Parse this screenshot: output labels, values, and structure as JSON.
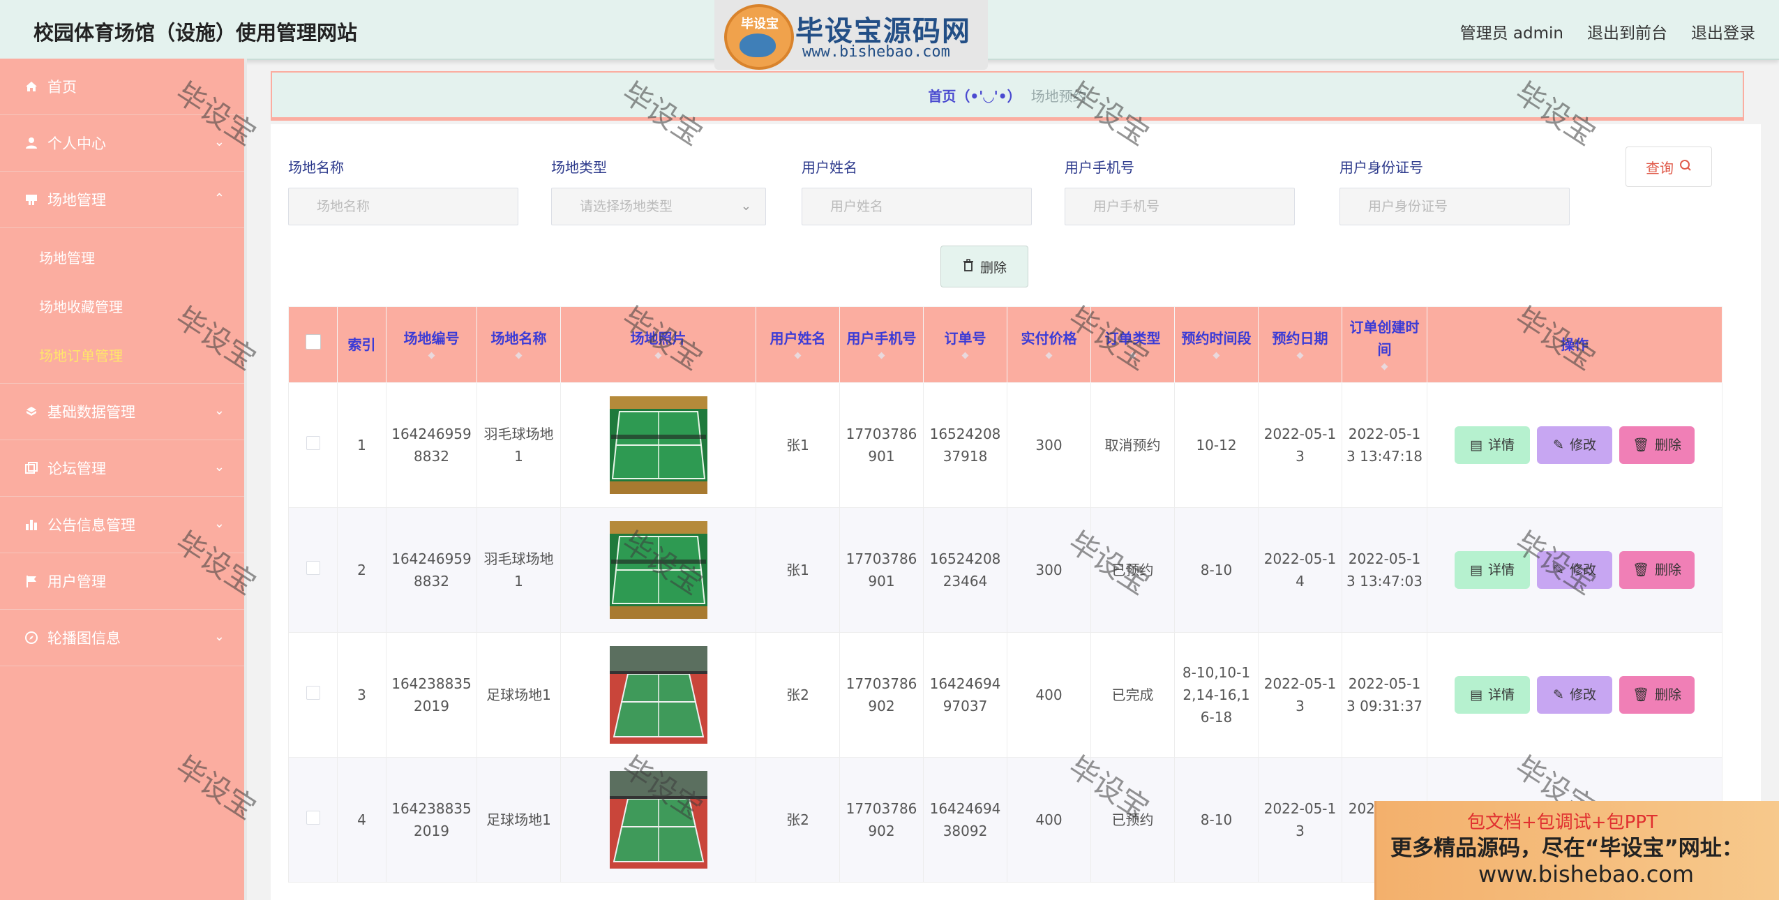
{
  "app": {
    "title": "校园体育场馆（设施）使用管理网站"
  },
  "header": {
    "user_label": "管理员 admin",
    "back_to_front": "退出到前台",
    "logout": "退出登录"
  },
  "logo": {
    "badge": "毕设宝",
    "main": "毕设宝源码网",
    "url": "www.bishebao.com"
  },
  "sidebar": {
    "items": [
      {
        "label": "首页",
        "icon": "home-icon"
      },
      {
        "label": "个人中心",
        "icon": "user-icon"
      },
      {
        "label": "场地管理",
        "icon": "venue-icon",
        "expanded": true,
        "children": [
          "场地管理",
          "场地收藏管理",
          "场地订单管理"
        ],
        "active_child": 2
      },
      {
        "label": "基础数据管理",
        "icon": "database-icon"
      },
      {
        "label": "论坛管理",
        "icon": "forum-icon"
      },
      {
        "label": "公告信息管理",
        "icon": "chart-icon"
      },
      {
        "label": "用户管理",
        "icon": "flag-icon"
      },
      {
        "label": "轮播图信息",
        "icon": "compass-icon"
      }
    ]
  },
  "breadcrumb": {
    "home": "首页（•'◡'•）",
    "current": "场地预约"
  },
  "search": {
    "fields": [
      {
        "label": "场地名称",
        "placeholder": "场地名称"
      },
      {
        "label": "场地类型",
        "placeholder": "请选择场地类型"
      },
      {
        "label": "用户姓名",
        "placeholder": "用户姓名"
      },
      {
        "label": "用户手机号",
        "placeholder": "用户手机号"
      },
      {
        "label": "用户身份证号",
        "placeholder": "用户身份证号"
      }
    ],
    "query_button": "查询",
    "delete_button": "删除"
  },
  "table": {
    "headers": [
      "索引",
      "场地编号",
      "场地名称",
      "场地照片",
      "用户姓名",
      "用户手机号",
      "订单号",
      "实付价格",
      "订单类型",
      "预约时间段",
      "预约日期",
      "订单创建时间",
      "操作"
    ],
    "rows": [
      {
        "index": "1",
        "venue_no": "1642469598832",
        "venue_name": "羽毛球场地1",
        "photo": "badminton",
        "user_name": "张1",
        "phone": "17703786901",
        "order_no": "1652420837918",
        "price": "300",
        "order_type": "取消预约",
        "time_slot": "10-12",
        "date": "2022-05-13",
        "created": "2022-05-13 13:47:18"
      },
      {
        "index": "2",
        "venue_no": "1642469598832",
        "venue_name": "羽毛球场地1",
        "photo": "badminton",
        "user_name": "张1",
        "phone": "17703786901",
        "order_no": "1652420823464",
        "price": "300",
        "order_type": "已预约",
        "time_slot": "8-10",
        "date": "2022-05-14",
        "created": "2022-05-13 13:47:03"
      },
      {
        "index": "3",
        "venue_no": "1642388352019",
        "venue_name": "足球场地1",
        "photo": "tennis",
        "user_name": "张2",
        "phone": "17703786902",
        "order_no": "1642469497037",
        "price": "400",
        "order_type": "已完成",
        "time_slot": "8-10,10-12,14-16,16-18",
        "date": "2022-05-13",
        "created": "2022-05-13 09:31:37"
      },
      {
        "index": "4",
        "venue_no": "1642388352019",
        "venue_name": "足球场地1",
        "photo": "tennis",
        "user_name": "张2",
        "phone": "17703786902",
        "order_no": "1642469438092",
        "price": "400",
        "order_type": "已预约",
        "time_slot": "8-10",
        "date": "2022-05-13",
        "created": "2022-05-13"
      }
    ],
    "actions": {
      "detail": "详情",
      "edit": "修改",
      "delete": "删除"
    }
  },
  "watermark": "毕设宝",
  "ad": {
    "line1": "包文档+包调试+包PPT",
    "line2": "更多精品源码，尽在“毕设宝”网址：",
    "line3": "www.bishebao.com"
  },
  "colors": {
    "sidebar": "#fbada0",
    "header": "#e4f2ee",
    "accent_text": "#3b3bd6",
    "active_menu": "#ffe66b"
  }
}
